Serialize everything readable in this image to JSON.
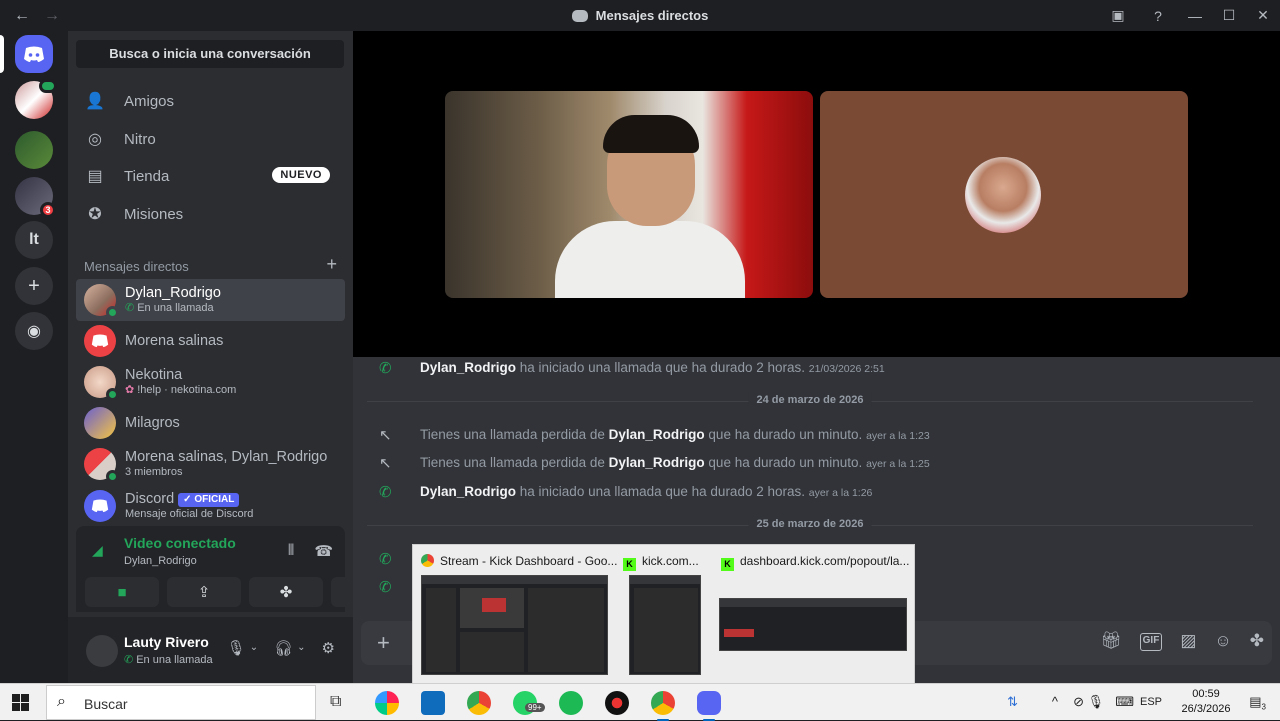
{
  "window": {
    "title": "Mensajes directos",
    "nav_back": "←",
    "nav_forward": "→",
    "controls": {
      "minimize": "—",
      "maximize": "☐",
      "close": "✕",
      "help": "?"
    }
  },
  "guilds": {
    "home_icon": "discord-logo-icon",
    "server_badge": "3",
    "text_server": "lt",
    "add_server": "+",
    "discover": "compass-icon"
  },
  "sidebar": {
    "search": "Busca o inicia una conversación",
    "nav": [
      {
        "label": "Amigos",
        "icon": "friends-icon"
      },
      {
        "label": "Nitro",
        "icon": "nitro-icon"
      },
      {
        "label": "Tienda",
        "icon": "store-icon",
        "badge": "NUEVO"
      },
      {
        "label": "Misiones",
        "icon": "quests-icon"
      }
    ],
    "dm_header": "Mensajes directos",
    "dm_add": "+",
    "dms": [
      {
        "name": "Dylan_Rodrigo",
        "sub": "En una llamada",
        "active": true,
        "avatar_color": "#8b6d5e"
      },
      {
        "name": "Morena salinas",
        "sub": "",
        "avatar_color": "#ed4245"
      },
      {
        "name": "Nekotina",
        "sub": "!help · nekotina.com",
        "avatar_color": "#e8c3b0"
      },
      {
        "name": "Milagros",
        "sub": "",
        "avatar_color": "#7b6fd6"
      },
      {
        "name": "Morena salinas, Dylan_Rodrigo",
        "sub": "3 miembros",
        "avatar_color": "#ed4245"
      },
      {
        "name": "Discord",
        "sub": "Mensaje oficial de Discord",
        "badge": "✓ OFICIAL",
        "avatar_color": "#5865f2"
      }
    ]
  },
  "voice": {
    "title": "Video conectado",
    "sub": "Dylan_Rodrigo"
  },
  "user": {
    "name": "Lauty Rivero",
    "status": "En una llamada"
  },
  "messages": [
    {
      "type": "call",
      "user": "Dylan_Rodrigo",
      "text": "ha iniciado una llamada que ha durado 2 horas.",
      "time": "21/03/2026 2:51"
    },
    {
      "type": "divider",
      "text": "24 de marzo de 2026"
    },
    {
      "type": "missed",
      "pre": "Tienes una llamada perdida de",
      "user": "Dylan_Rodrigo",
      "text": "que ha durado un minuto.",
      "time": "ayer a la 1:23"
    },
    {
      "type": "missed",
      "pre": "Tienes una llamada perdida de",
      "user": "Dylan_Rodrigo",
      "text": "que ha durado un minuto.",
      "time": "ayer a la 1:25"
    },
    {
      "type": "call",
      "user": "Dylan_Rodrigo",
      "text": "ha iniciado una llamada que ha durado 2 horas.",
      "time": "ayer a la 1:26"
    },
    {
      "type": "divider",
      "text": "25 de marzo de 2026"
    }
  ],
  "preview": {
    "tabs": [
      {
        "title": "Stream - Kick Dashboard - Goo..."
      },
      {
        "title": "kick.com..."
      },
      {
        "title": "dashboard.kick.com/popout/la..."
      }
    ]
  },
  "taskbar": {
    "search": "Buscar",
    "whatsapp_badge": "99+",
    "lang": "ESP",
    "time": "00:59",
    "date": "26/3/2026",
    "notif_count": "3"
  }
}
